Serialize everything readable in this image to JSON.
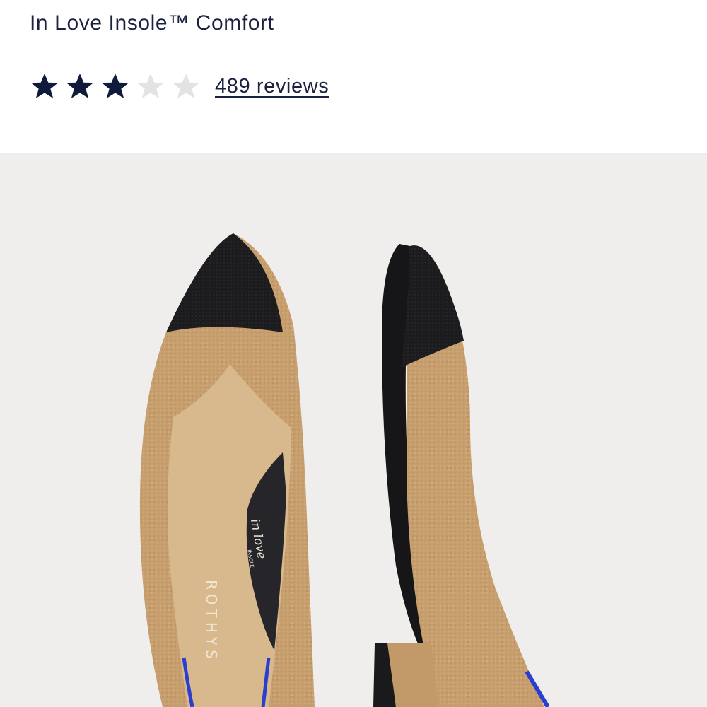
{
  "product": {
    "title": "In Love Insole™ Comfort",
    "rating": {
      "value": 3,
      "max": 5,
      "filled_color": "#0f1a3c",
      "empty_color": "#e3e3e3"
    },
    "reviews_label": "489 reviews"
  },
  "image": {
    "subject": "shoe-photo",
    "insole_logo_text": "in love",
    "insole_logo_sub": "INSOLE",
    "insole_brand_text": "ROTHYS",
    "colors": {
      "background": "#efeeec",
      "upper": "#c8a070",
      "toe": "#1b1b1d",
      "insole": "#d7b68a",
      "piping": "#2a3fd0"
    }
  }
}
